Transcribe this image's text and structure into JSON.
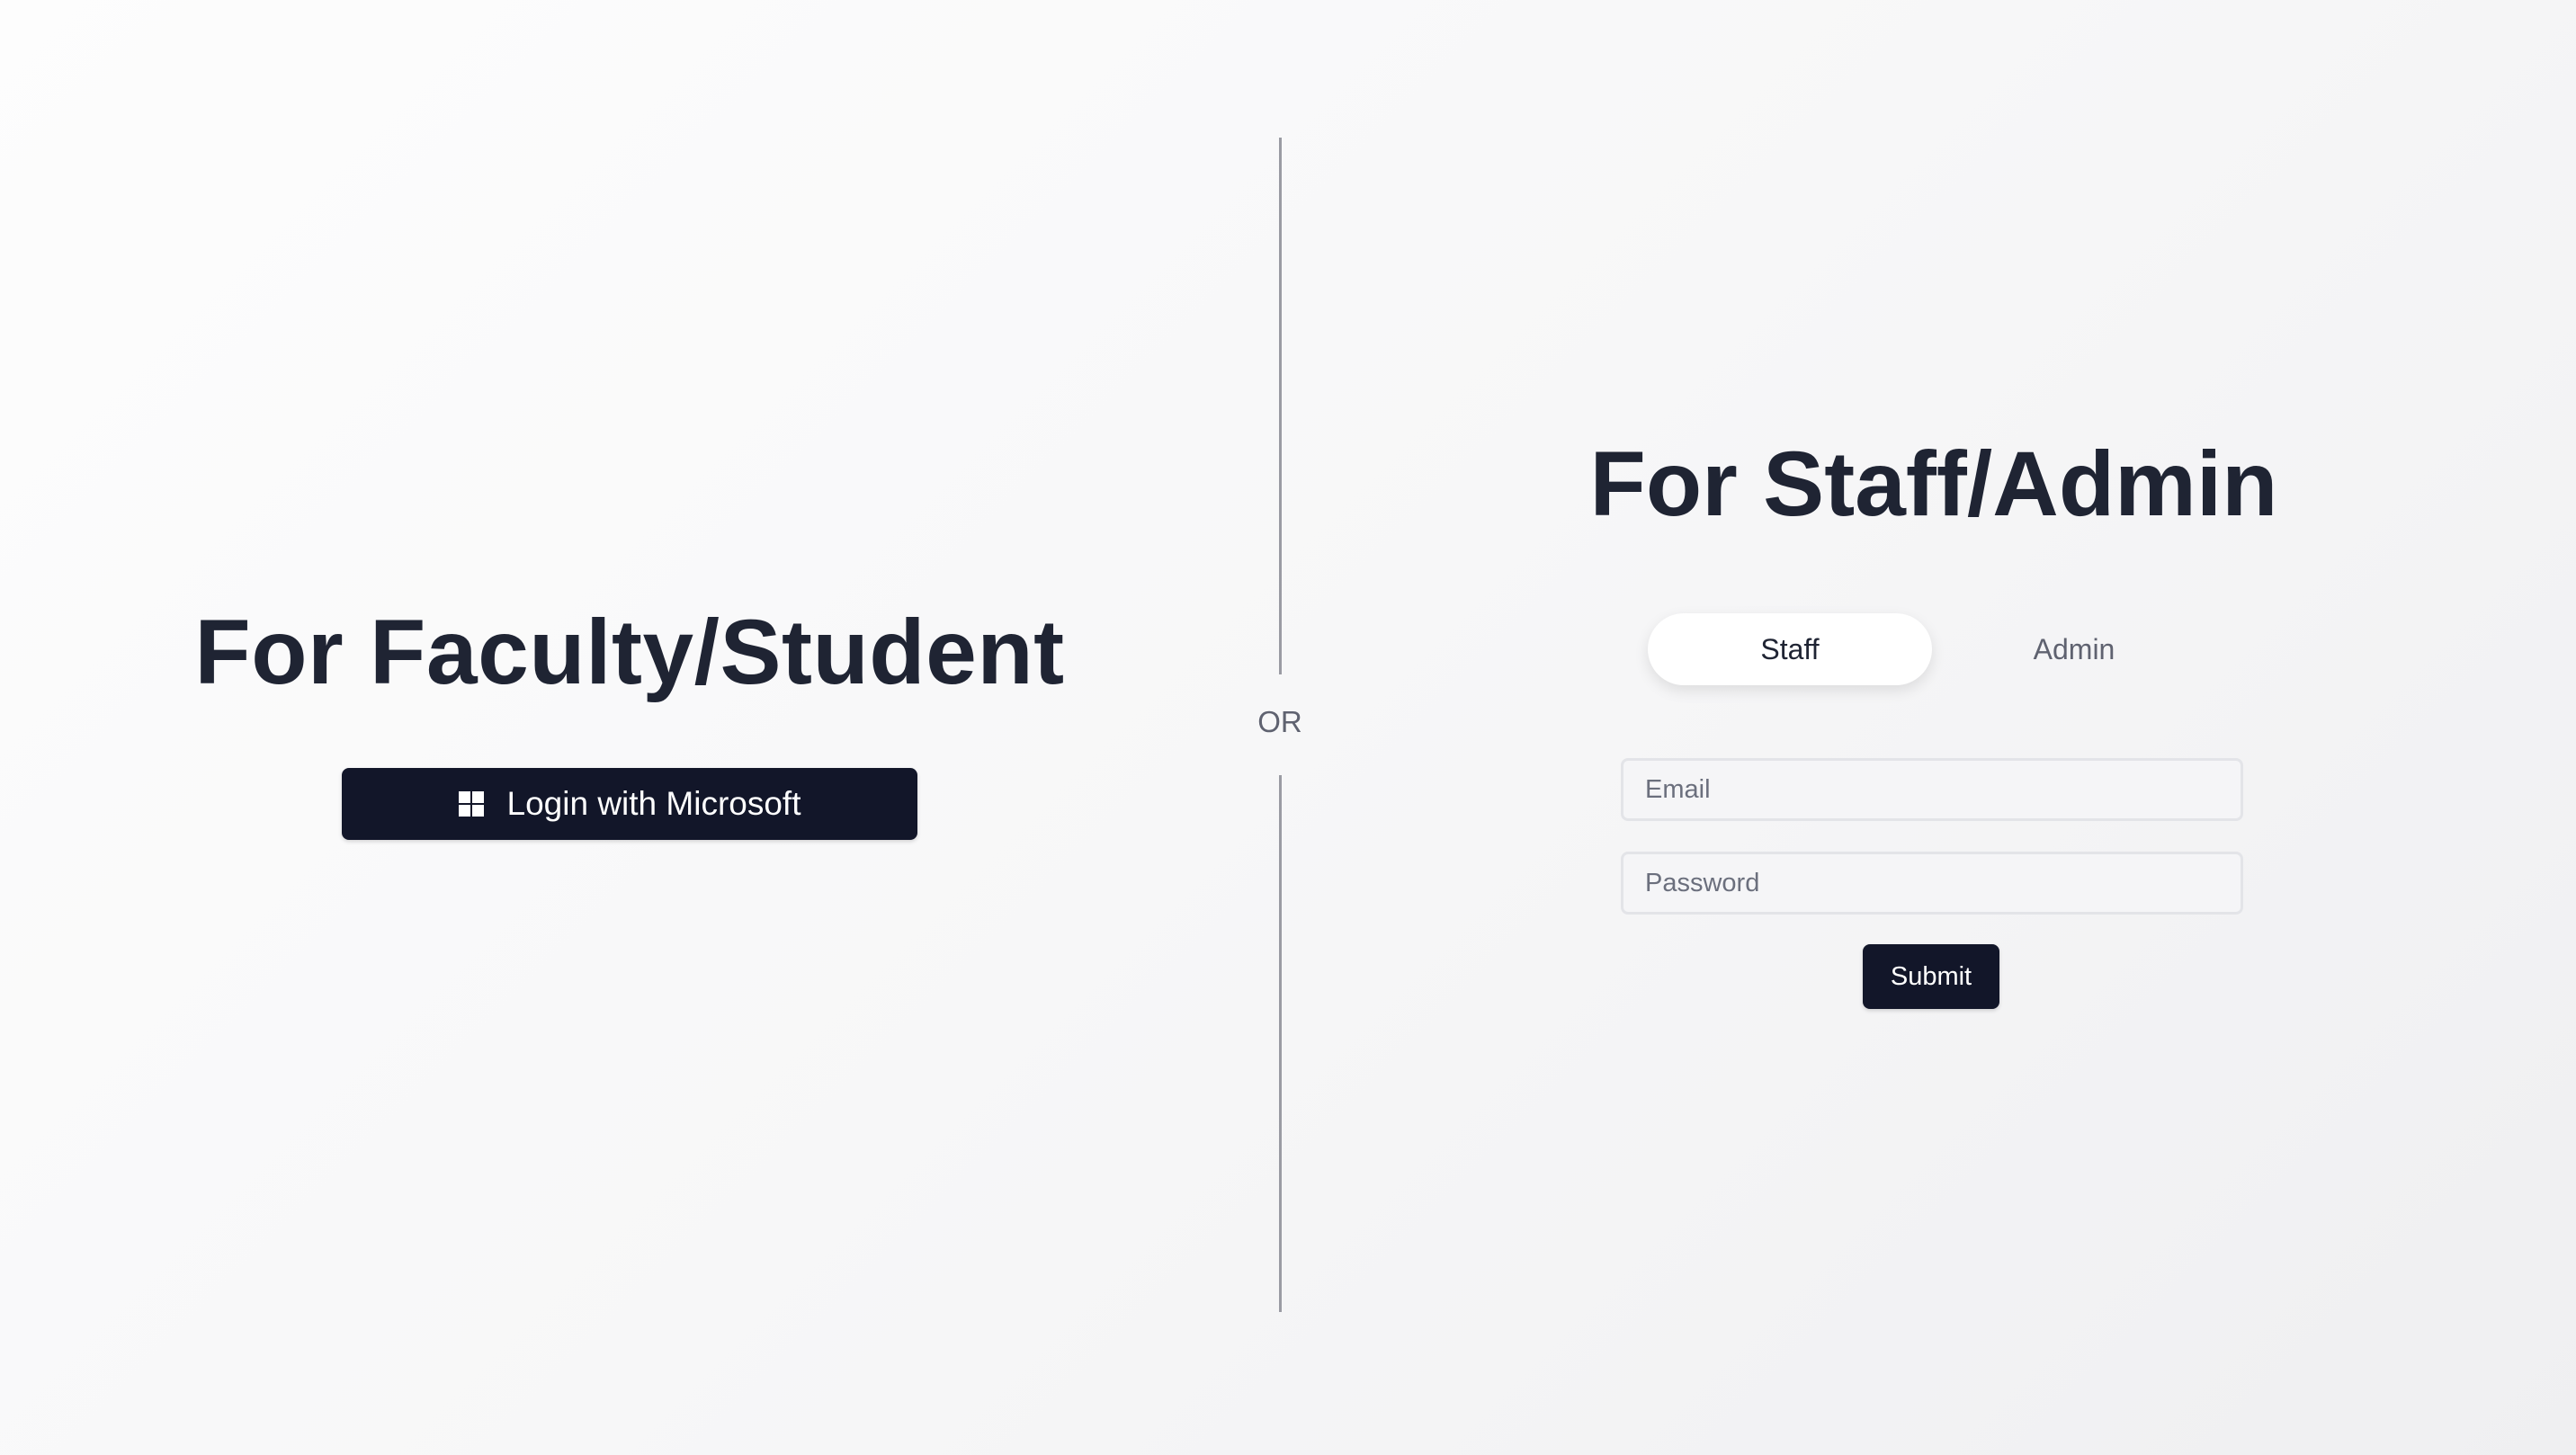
{
  "faculty_section": {
    "title": "For Faculty/Student",
    "login_button_label": "Login with Microsoft",
    "login_button_icon": "windows-icon"
  },
  "divider": {
    "label": "OR"
  },
  "staff_section": {
    "title": "For Staff/Admin",
    "tabs": [
      {
        "label": "Staff",
        "selected": true
      },
      {
        "label": "Admin",
        "selected": false
      }
    ],
    "email": {
      "value": "",
      "placeholder": "Email"
    },
    "password": {
      "value": "",
      "placeholder": "Password"
    },
    "submit_label": "Submit"
  },
  "colors": {
    "button_bg": "#121629",
    "heading_text": "#1f2433",
    "muted_text": "#5f6270",
    "divider_line": "#9a9ba3"
  }
}
